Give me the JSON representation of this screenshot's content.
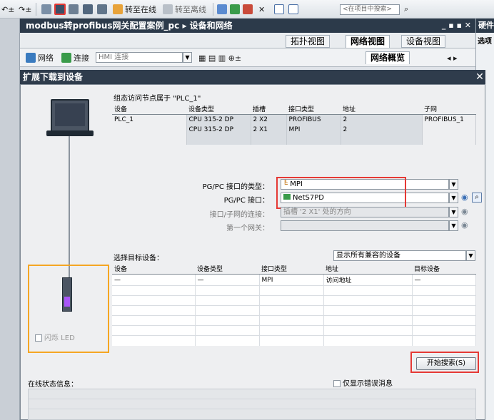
{
  "toolbar": {
    "go_online": "转至在线",
    "go_offline": "转至离线",
    "search_placeholder": "<在项目中搜索>"
  },
  "title": {
    "project": "modbus转profibus网关配置案例_pc",
    "sep": "▸",
    "section": "设备和网络"
  },
  "right_panel": {
    "title": "硬件",
    "sub": "选项"
  },
  "view_tabs": {
    "topology": "拓扑视图",
    "network": "网络视图",
    "device": "设备视图",
    "overview": "网络概览"
  },
  "net_toolbar": {
    "network": "网络",
    "connection": "连接",
    "hmi_connection": "HMI 连接"
  },
  "dialog": {
    "title": "扩展下载到设备",
    "close": "✕",
    "config_heading": "组态访问节点属于 \"PLC_1\"",
    "config_table": {
      "headers": [
        "设备",
        "设备类型",
        "插槽",
        "接口类型",
        "地址",
        "子网"
      ],
      "rows": [
        [
          "PLC_1",
          "CPU 315-2 DP",
          "2 X2",
          "PROFIBUS",
          "2",
          "PROFIBUS_1"
        ],
        [
          "",
          "CPU 315-2 DP",
          "2 X1",
          "MPI",
          "2",
          ""
        ]
      ]
    },
    "pgpc_type_label": "PG/PC 接口的类型：",
    "pgpc_type_value": "MPI",
    "pgpc_iface_label": "PG/PC 接口：",
    "pgpc_iface_value": "NetS7PD",
    "subnet_conn_label": "接口/子网的连接：",
    "subnet_conn_value": "插槽 '2 X1' 处的方向",
    "first_gateway_label": "第一个网关：",
    "first_gateway_value": "",
    "select_target_label": "选择目标设备：",
    "filter_value": "显示所有兼容的设备",
    "target_table": {
      "headers": [
        "设备",
        "设备类型",
        "接口类型",
        "地址",
        "目标设备"
      ],
      "rows": [
        [
          "—",
          "—",
          "MPI",
          "访问地址",
          "—"
        ]
      ]
    },
    "flash_led": "闪烁 LED",
    "start_search": "开始搜索(S)",
    "online_status": "在线状态信息：",
    "only_errors": "仅显示错误消息"
  }
}
